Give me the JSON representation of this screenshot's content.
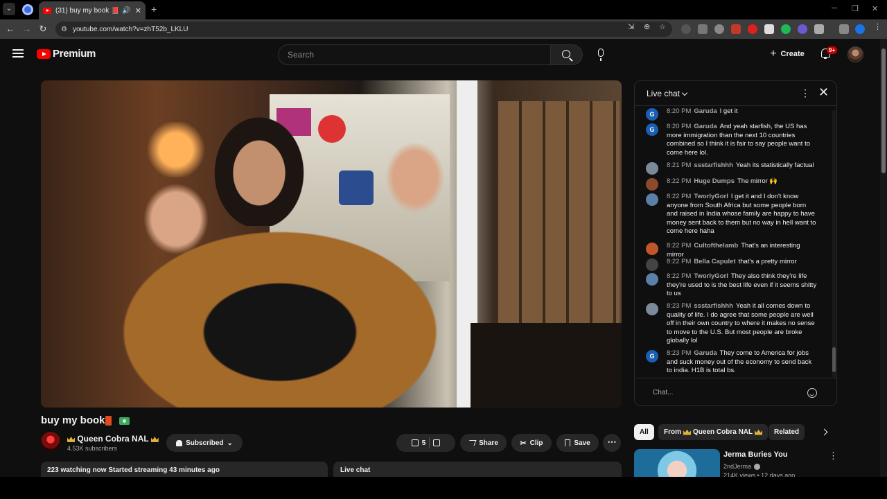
{
  "browser": {
    "tab_title": "(31) buy my book 📕 💵 -",
    "url": "youtube.com/watch?v=zhT52b_LKLU"
  },
  "header": {
    "logo": "Premium",
    "search_placeholder": "Search",
    "create_label": "Create",
    "notifications": "9+"
  },
  "video": {
    "title": "buy my book",
    "channel": "Queen Cobra NAL",
    "subscribers": "4.53K subscribers",
    "subscribed_label": "Subscribed",
    "likes": "5",
    "share_label": "Share",
    "clip_label": "Clip",
    "save_label": "Save",
    "watching": "223 watching now  Started streaming 43 minutes ago",
    "livechat_label": "Live chat"
  },
  "chat": {
    "title": "Live chat",
    "input_placeholder": "Chat...",
    "messages": [
      {
        "time": "8:20 PM",
        "author": "Garuda",
        "text": "I get it",
        "initial": "G",
        "color": "#1a5fb4"
      },
      {
        "time": "8:20 PM",
        "author": "Garuda",
        "text": "And yeah starfish, the US has more immigration than the next 10 countries combined so I think it is fair to say people want to come here lol.",
        "initial": "G",
        "color": "#1a5fb4"
      },
      {
        "time": "8:21 PM",
        "author": "ssstarfishhh",
        "text": "Yeah its statistically factual",
        "initial": "",
        "color": "#7a8a99"
      },
      {
        "time": "8:22 PM",
        "author": "Huge Dumps",
        "text": "The mirror 🙌",
        "initial": "",
        "color": "#8a4b2c"
      },
      {
        "time": "8:22 PM",
        "author": "TworlyGorl",
        "text": "I get it and I don't know anyone from South Africa but some people born and raised in India whose family are happy to have money sent back to them but no way in hell want to come here haha",
        "initial": "",
        "color": "#5b7fa6"
      },
      {
        "time": "8:22 PM",
        "author": "Cultofthelamb",
        "text": "That's an interesting mirror",
        "initial": "",
        "color": "#c0572a"
      },
      {
        "time": "8:22 PM",
        "author": "Bella Capulet",
        "text": "that's a pretty mirror",
        "initial": "",
        "color": "#444444"
      },
      {
        "time": "8:22 PM",
        "author": "TworlyGorl",
        "text": "They also think they're life they're used to is the best life even if it seems shitty to us",
        "initial": "",
        "color": "#5b7fa6"
      },
      {
        "time": "8:23 PM",
        "author": "ssstarfishhh",
        "text": "Yeah it all comes down to quality of life. I do agree that some people are well off in their own country to where it makes no sense to move to the U.S. But most people are broke globally lol",
        "initial": "",
        "color": "#7a8a99"
      },
      {
        "time": "8:23 PM",
        "author": "Garuda",
        "text": "They come to America for jobs and suck money out of the economy to send back to india. H1B is total bs.",
        "initial": "G",
        "color": "#1a5fb4"
      }
    ]
  },
  "chips": {
    "all": "All",
    "from": "From",
    "from_channel": "Queen Cobra NAL",
    "related": "Related"
  },
  "recommendation": {
    "title": "Jerma Buries You",
    "channel": "2ndJerma",
    "meta": "214K views • 12 days ago"
  }
}
